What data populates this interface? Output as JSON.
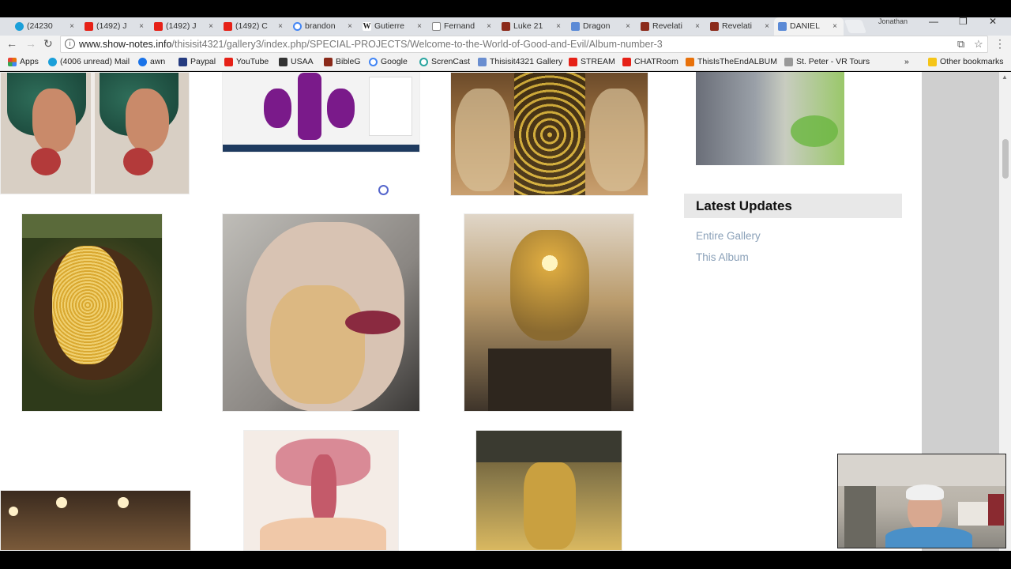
{
  "tabs": [
    {
      "title": "(24230",
      "close": "×",
      "color": "#1a9fd9"
    },
    {
      "title": "(1492) J",
      "close": "×",
      "color": "#e62117"
    },
    {
      "title": "(1492) J",
      "close": "×",
      "color": "#e62117"
    },
    {
      "title": "(1492) C",
      "close": "×",
      "color": "#e62117"
    },
    {
      "title": "brandon",
      "close": "×",
      "color": "#4285f4"
    },
    {
      "title": "Gutierre",
      "close": "×",
      "color": "#333333"
    },
    {
      "title": "Fernand",
      "close": "×",
      "color": "#888888"
    },
    {
      "title": "Luke 21",
      "close": "×",
      "color": "#8b2a1a"
    },
    {
      "title": "Dragon",
      "close": "×",
      "color": "#5b8ad6"
    },
    {
      "title": "Revelati",
      "close": "×",
      "color": "#8b2a1a"
    },
    {
      "title": "Revelati",
      "close": "×",
      "color": "#8b2a1a"
    },
    {
      "title": "DANIEL",
      "close": "×",
      "color": "#5b8ad6"
    }
  ],
  "window": {
    "user": "Jonathan",
    "minimize": "—",
    "restore": "❐",
    "close": "✕"
  },
  "toolbar": {
    "back": "←",
    "forward": "→",
    "reload": "↻",
    "url_host": "www.show-notes.info",
    "url_path": "/thisisit4321/gallery3/index.php/SPECIAL-PROJECTS/Welcome-to-the-World-of-Good-and-Evil/Album-number-3",
    "info": "i",
    "translate": "⧉",
    "star": "☆",
    "menu": "⋮"
  },
  "bookmarks": [
    {
      "label": "Apps",
      "color": "#e8710a"
    },
    {
      "label": "(4006 unread) Mail",
      "color": "#1a9fd9"
    },
    {
      "label": "awn",
      "color": "#1a73e8"
    },
    {
      "label": "Paypal",
      "color": "#253b80"
    },
    {
      "label": "YouTube",
      "color": "#e62117"
    },
    {
      "label": "USAA",
      "color": "#333333"
    },
    {
      "label": "BibleG",
      "color": "#8b2a1a"
    },
    {
      "label": "Google",
      "color": "#4285f4"
    },
    {
      "label": "ScrenCast",
      "color": "#2aa5a0"
    },
    {
      "label": "Thisisit4321 Gallery",
      "color": "#6a8ed0"
    },
    {
      "label": "STREAM",
      "color": "#e62117"
    },
    {
      "label": "CHATRoom",
      "color": "#e62117"
    },
    {
      "label": "ThisIsTheEndALBUM",
      "color": "#e8710a"
    },
    {
      "label": "St. Peter - VR Tours",
      "color": "#666666"
    }
  ],
  "bookmarks_overflow": "»",
  "other_bookmarks": "Other bookmarks",
  "sidebar": {
    "heading": "Latest Updates",
    "links": [
      "Entire Gallery",
      "This Album"
    ]
  }
}
